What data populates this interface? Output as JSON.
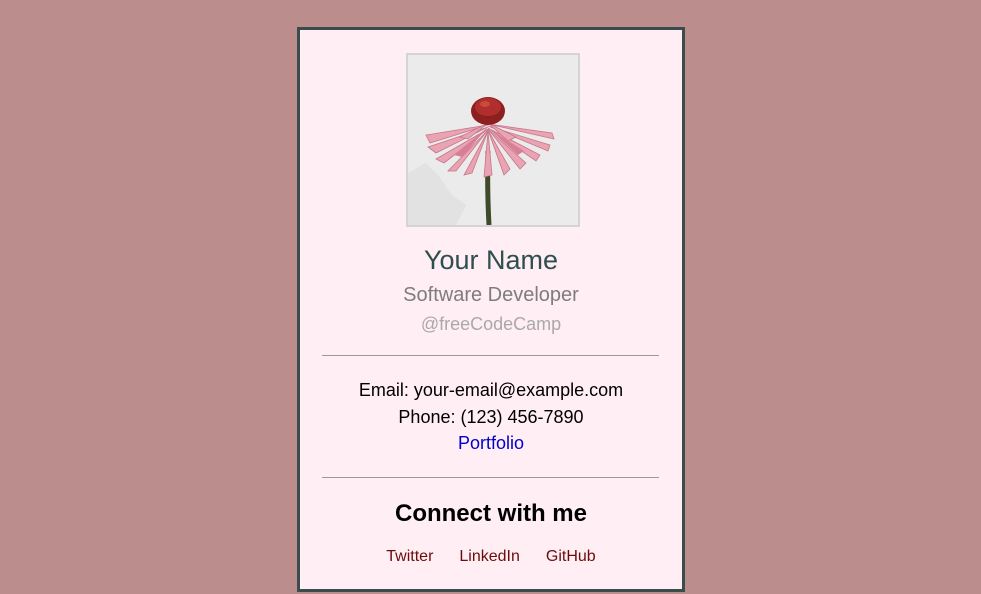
{
  "profile": {
    "photo_icon": "coneflower-photo",
    "name": "Your Name",
    "title": "Software Developer",
    "handle": "@freeCodeCamp"
  },
  "contact": {
    "email": "Email: your-email@example.com",
    "phone": "Phone: (123) 456-7890",
    "portfolio_label": "Portfolio"
  },
  "connect": {
    "heading": "Connect with me",
    "links": [
      "Twitter",
      "LinkedIn",
      "GitHub"
    ]
  },
  "colors": {
    "page_background": "#bb8e8d",
    "card_background": "#ffeef3",
    "card_border": "#3b4c4c",
    "name": "#2f4f4f",
    "link": "#0000cc",
    "social_link": "#6b0c0c"
  }
}
